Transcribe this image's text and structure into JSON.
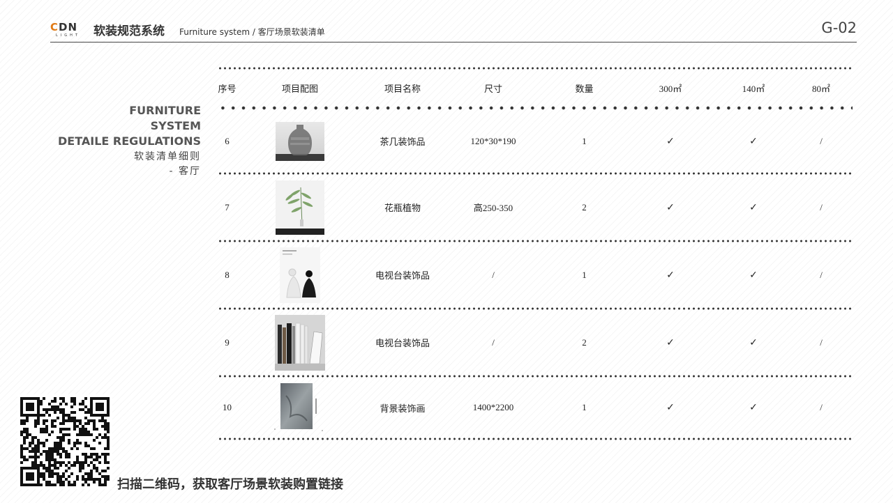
{
  "header": {
    "logo_main_c": "C",
    "logo_main_rest": "DN",
    "logo_sub": "LIGHT",
    "system_title": "软装规范系统",
    "subtitle": "Furniture system /  客厅场景软装清单",
    "page_code": "G-02"
  },
  "left_heading": {
    "en_line1": "FURNITURE",
    "en_line2": "SYSTEM",
    "en_line3": "DETAILE REGULATIONS",
    "cn_line1": "软装清单细则",
    "cn_line2": "- 客厅"
  },
  "table": {
    "columns": [
      "序号",
      "项目配图",
      "项目名称",
      "尺寸",
      "数量",
      "300㎡",
      "140㎡",
      "80㎡"
    ],
    "rows": [
      {
        "no": "6",
        "name": "茶几装饰品",
        "size": "120*30*190",
        "qty": "1",
        "a": "✓",
        "b": "✓",
        "c": "/",
        "image": "glass-vase-image"
      },
      {
        "no": "7",
        "name": "花瓶植物",
        "size": "高250-350",
        "qty": "2",
        "a": "✓",
        "b": "✓",
        "c": "/",
        "image": "plant-vase-image"
      },
      {
        "no": "8",
        "name": "电视台装饰品",
        "size": "/",
        "qty": "1",
        "a": "✓",
        "b": "✓",
        "c": "/",
        "image": "figurine-image"
      },
      {
        "no": "9",
        "name": "电视台装饰品",
        "size": "/",
        "qty": "2",
        "a": "✓",
        "b": "✓",
        "c": "/",
        "image": "books-image"
      },
      {
        "no": "10",
        "name": "背景装饰画",
        "size": "1400*2200",
        "qty": "1",
        "a": "✓",
        "b": "✓",
        "c": "/",
        "image": "painting-image"
      }
    ]
  },
  "qr": {
    "caption": "扫描二维码，获取客厅场景软装购置链接",
    "icon": "qr-code-icon"
  },
  "colors": {
    "logo_accent": "#e07a16",
    "text_dark": "#333333"
  }
}
